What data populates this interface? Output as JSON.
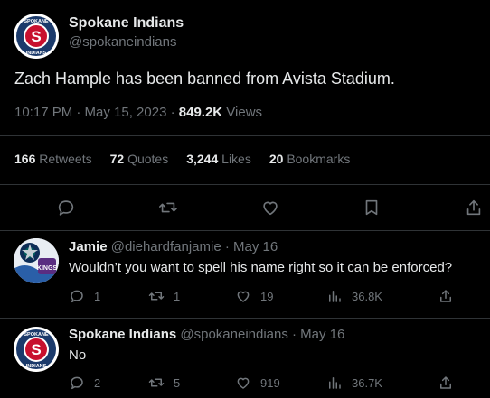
{
  "colors": {
    "background": "#000000",
    "text": "#e7e9ea",
    "muted": "#71767b",
    "divider": "#2f3336",
    "brand_red": "#c8102e",
    "brand_navy": "#1b3a6b"
  },
  "main_tweet": {
    "author_name": "Spokane Indians",
    "author_handle": "@spokaneindians",
    "avatar_text_top": "SPOKANE",
    "avatar_text_bottom": "INDIANS",
    "avatar_letter": "S",
    "text": "Zach Hample has been banned from Avista Stadium.",
    "time": "10:17 PM · May 15, 2023 · ",
    "views_count": "849.2K",
    "views_label": " Views",
    "stats": {
      "retweets_count": "166",
      "retweets_label": "Retweets",
      "quotes_count": "72",
      "quotes_label": "Quotes",
      "likes_count": "3,244",
      "likes_label": "Likes",
      "bookmarks_count": "20",
      "bookmarks_label": "Bookmarks"
    },
    "action_icons": [
      "reply-icon",
      "retweet-icon",
      "like-icon",
      "bookmark-icon",
      "share-icon"
    ]
  },
  "replies": [
    {
      "author_name": "Jamie",
      "author_meta": "@diehardfanjamie · May 16",
      "text": "Wouldn’t you want to spell his name right so it can be enforced?",
      "replies": "1",
      "retweets": "1",
      "likes": "19",
      "views": "36.8K"
    },
    {
      "author_name": "Spokane Indians",
      "author_meta": "@spokaneindians · May 16",
      "text": "No",
      "replies": "2",
      "retweets": "5",
      "likes": "919",
      "views": "36.7K"
    }
  ]
}
